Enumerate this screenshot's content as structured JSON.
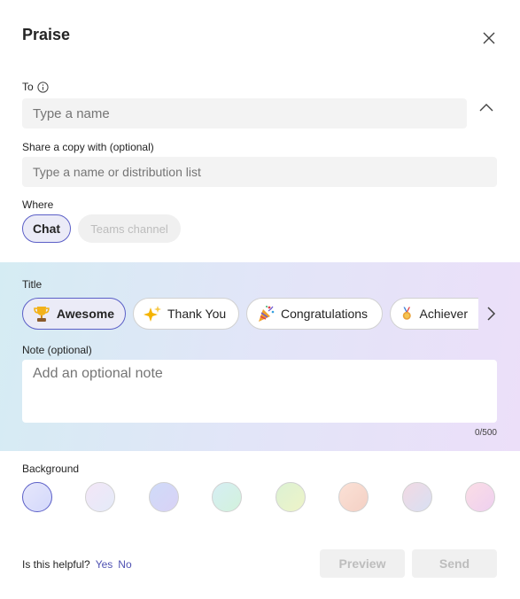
{
  "dialog": {
    "title": "Praise"
  },
  "to": {
    "label": "To",
    "placeholder": "Type a name"
  },
  "share": {
    "label": "Share a copy with (optional)",
    "placeholder": "Type a name or distribution list"
  },
  "where": {
    "label": "Where",
    "options": [
      {
        "label": "Chat",
        "selected": true
      },
      {
        "label": "Teams channel",
        "selected": false
      }
    ]
  },
  "title_section": {
    "label": "Title",
    "badges": [
      {
        "label": "Awesome",
        "icon": "trophy-icon",
        "selected": true
      },
      {
        "label": "Thank You",
        "icon": "sparkles-icon",
        "selected": false
      },
      {
        "label": "Congratulations",
        "icon": "party-popper-icon",
        "selected": false
      },
      {
        "label": "Achiever",
        "icon": "medal-icon",
        "selected": false
      }
    ]
  },
  "note": {
    "label": "Note (optional)",
    "placeholder": "Add an optional note",
    "counter": "0/500"
  },
  "background": {
    "label": "Background",
    "swatches": [
      {
        "colors": [
          "#e6e7fb",
          "#d3d8fb"
        ],
        "selected": true
      },
      {
        "colors": [
          "#f3e6f7",
          "#e4ebf8"
        ],
        "selected": false
      },
      {
        "colors": [
          "#cfdbf8",
          "#d9d2f6"
        ],
        "selected": false
      },
      {
        "colors": [
          "#d6eef4",
          "#d2f2dc"
        ],
        "selected": false
      },
      {
        "colors": [
          "#dcf1d3",
          "#eef4c8"
        ],
        "selected": false
      },
      {
        "colors": [
          "#fbe1d6",
          "#f4d0c4"
        ],
        "selected": false
      },
      {
        "colors": [
          "#f2d9e3",
          "#d8e0f3"
        ],
        "selected": false
      },
      {
        "colors": [
          "#fbdde5",
          "#eed0f0"
        ],
        "selected": false
      }
    ]
  },
  "footer": {
    "helpful_text": "Is this helpful?",
    "yes": "Yes",
    "no": "No",
    "preview": "Preview",
    "send": "Send"
  },
  "colors": {
    "accent": "#5b5fc7",
    "link": "#4f52b2"
  }
}
